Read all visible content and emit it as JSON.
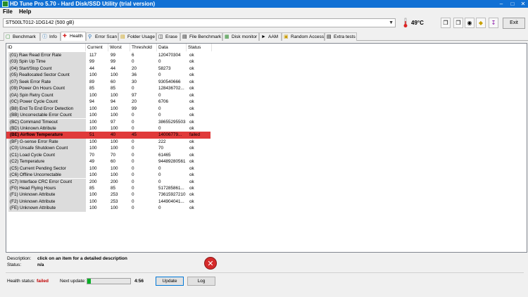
{
  "window": {
    "title": "HD Tune Pro 5.70 - Hard Disk/SSD Utility (trial version)",
    "min": "–",
    "max": "□",
    "close": "✕"
  },
  "menu": [
    "File",
    "Help"
  ],
  "toolbar": {
    "drive": "ST500LT012-1DG142 (500 gB)",
    "temperature": "49°C",
    "exit_label": "Exit"
  },
  "tabs": [
    {
      "label": "Benchmark",
      "icon": "benchmark-icon"
    },
    {
      "label": "Info",
      "icon": "info-icon"
    },
    {
      "label": "Health",
      "icon": "health-icon"
    },
    {
      "label": "Error Scan",
      "icon": "magnifier-icon"
    },
    {
      "label": "Folder Usage",
      "icon": "folder-icon"
    },
    {
      "label": "Erase",
      "icon": "erase-icon"
    },
    {
      "label": "File Benchmark",
      "icon": "file-icon"
    },
    {
      "label": "Disk monitor",
      "icon": "monitor-icon"
    },
    {
      "label": "AAM",
      "icon": "speaker-icon"
    },
    {
      "label": "Random Access",
      "icon": "random-icon"
    },
    {
      "label": "Extra tests",
      "icon": "tests-icon"
    }
  ],
  "table": {
    "headers": [
      "ID",
      "Current",
      "Worst",
      "Threshold",
      "Data",
      "Status"
    ],
    "rows": [
      [
        "(01) Raw Read Error Rate",
        "117",
        "99",
        "6",
        "120470304",
        "ok"
      ],
      [
        "(03) Spin Up Time",
        "99",
        "99",
        "0",
        "0",
        "ok"
      ],
      [
        "(04) Start/Stop Count",
        "44",
        "44",
        "20",
        "58273",
        "ok"
      ],
      [
        "(05) Reallocated Sector Count",
        "100",
        "100",
        "36",
        "0",
        "ok"
      ],
      [
        "(07) Seek Error Rate",
        "89",
        "60",
        "30",
        "930540666",
        "ok"
      ],
      [
        "(09) Power On Hours Count",
        "85",
        "85",
        "0",
        "128436702...",
        "ok"
      ],
      [
        "(0A) Spin Retry Count",
        "100",
        "100",
        "97",
        "0",
        "ok"
      ],
      [
        "(0C) Power Cycle Count",
        "94",
        "94",
        "20",
        "6706",
        "ok"
      ],
      [
        "(B8) End To End Error Detection",
        "100",
        "100",
        "99",
        "0",
        "ok"
      ],
      [
        "(BB) Uncorrectable Error Count",
        "100",
        "100",
        "0",
        "0",
        "ok"
      ],
      [
        "(BC) Command Timeout",
        "100",
        "97",
        "0",
        "38655295503",
        "ok"
      ],
      [
        "(BD) Unknown Attribute",
        "100",
        "100",
        "0",
        "0",
        "ok"
      ],
      [
        "(BE) Airflow Temperature",
        "51",
        "40",
        "45",
        "14006779...",
        "failed"
      ],
      [
        "(BF) G-sense Error Rate",
        "100",
        "100",
        "0",
        "222",
        "ok"
      ],
      [
        "(C0) Unsafe Shutdown Count",
        "100",
        "100",
        "0",
        "70",
        "ok"
      ],
      [
        "(C1) Load Cycle Count",
        "70",
        "70",
        "0",
        "61465",
        "ok"
      ],
      [
        "(C2) Temperature",
        "49",
        "60",
        "0",
        "94489280561",
        "ok"
      ],
      [
        "(C5) Current Pending Sector",
        "100",
        "100",
        "0",
        "0",
        "ok"
      ],
      [
        "(C6) Offline Uncorrectable",
        "100",
        "100",
        "0",
        "0",
        "ok"
      ],
      [
        "(C7) Interface CRC Error Count",
        "200",
        "200",
        "0",
        "0",
        "ok"
      ],
      [
        "(F0) Head Flying Hours",
        "85",
        "85",
        "0",
        "517285861...",
        "ok"
      ],
      [
        "(F1) Unknown Attribute",
        "100",
        "253",
        "0",
        "73615927210",
        "ok"
      ],
      [
        "(F2) Unknown Attribute",
        "100",
        "253",
        "0",
        "144904041...",
        "ok"
      ],
      [
        "(FE) Unknown Attribute",
        "100",
        "100",
        "0",
        "0",
        "ok"
      ]
    ]
  },
  "description": {
    "label": "Description:",
    "value": "click on an item for a detailed description",
    "status_label": "Status:",
    "status_value": "n/a"
  },
  "footer": {
    "health_label": "Health status:",
    "health_value": "failed",
    "next_update_label": "Next update:",
    "timer": "4:56",
    "update_label": "Update",
    "log_label": "Log",
    "progress": 0.08
  },
  "colors": {
    "failed_row": "#e03a3a",
    "title_bar": "#1170d4"
  }
}
